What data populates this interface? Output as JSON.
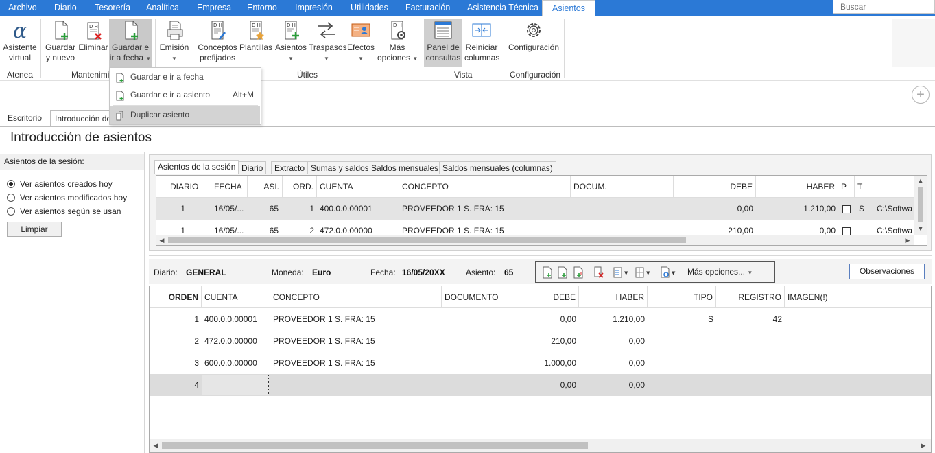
{
  "menu": [
    "Archivo",
    "Diario",
    "Tesorería",
    "Analítica",
    "Empresa",
    "Entorno",
    "Impresión",
    "Utilidades",
    "Facturación",
    "Asistencia Técnica",
    "Asientos"
  ],
  "search_placeholder": "Buscar",
  "ribbon": {
    "buttons": {
      "asistente": [
        "Asistente",
        "virtual"
      ],
      "guardar_nuevo": [
        "Guardar",
        "y nuevo"
      ],
      "eliminar": "Eliminar",
      "guardar_fecha": [
        "Guardar e",
        "ir a fecha"
      ],
      "emision": "Emisión",
      "conceptos": [
        "Conceptos",
        "prefijados"
      ],
      "plantillas": "Plantillas",
      "asientos": "Asientos",
      "traspasos": "Traspasos",
      "efectos": "Efectos",
      "mas_opciones": [
        "Más",
        "opciones"
      ],
      "panel": [
        "Panel de",
        "consultas"
      ],
      "reiniciar": [
        "Reiniciar",
        "columnas"
      ],
      "configuracion": "Configuración"
    },
    "groups": {
      "atenea": "Atenea",
      "mantenimiento": "Mantenimi",
      "utiles": "Útiles",
      "vista": "Vista",
      "configuracion": "Configuración"
    }
  },
  "dropdown": {
    "items": [
      {
        "label": "Guardar e ir a fecha",
        "shortcut": ""
      },
      {
        "label": "Guardar e ir a asiento",
        "shortcut": "Alt+M"
      },
      {
        "label": "Duplicar asiento",
        "shortcut": ""
      }
    ]
  },
  "page_tabs": [
    "Escritorio",
    "Introducción de"
  ],
  "page_title": "Introducción de asientos",
  "session": {
    "header": "Asientos de la sesión:",
    "options": [
      "Ver asientos creados hoy",
      "Ver asientos modificados hoy",
      "Ver asientos según se usan"
    ],
    "selected_index": 0,
    "clear_button": "Limpiar"
  },
  "upper_tabs": [
    "Asientos de la sesión",
    "Diario",
    "Extracto",
    "Sumas y saldos",
    "Saldos mensuales",
    "Saldos mensuales (columnas)"
  ],
  "upper_grid": {
    "columns": [
      "DIARIO",
      "FECHA",
      "ASI.",
      "ORD.",
      "CUENTA",
      "CONCEPTO",
      "DOCUM.",
      "DEBE",
      "HABER",
      "P",
      "T",
      ""
    ],
    "rows": [
      {
        "diario": "1",
        "fecha": "16/05/...",
        "asi": "65",
        "ord": "1",
        "cuenta": "400.0.0.00001",
        "concepto": "PROVEEDOR 1 S. FRA:  15",
        "docum": "",
        "debe": "0,00",
        "haber": "1.210,00",
        "t": "S",
        "ruta": "C:\\Softwa"
      },
      {
        "diario": "1",
        "fecha": "16/05/...",
        "asi": "65",
        "ord": "2",
        "cuenta": "472.0.0.00000",
        "concepto": "PROVEEDOR 1 S. FRA:  15",
        "docum": "",
        "debe": "210,00",
        "haber": "0,00",
        "t": "",
        "ruta": "C:\\Softwa"
      }
    ]
  },
  "entry": {
    "diario_label": "Diario:",
    "diario_value": "GENERAL",
    "moneda_label": "Moneda:",
    "moneda_value": "Euro",
    "fecha_label": "Fecha:",
    "fecha_value": "16/05/20XX",
    "asiento_label": "Asiento:",
    "asiento_value": "65",
    "more_options": "Más opciones...",
    "observaciones": "Observaciones"
  },
  "lines_grid": {
    "columns": [
      "ORDEN",
      "CUENTA",
      "CONCEPTO",
      "DOCUMENTO",
      "DEBE",
      "HABER",
      "TIPO",
      "REGISTRO",
      "IMAGEN(!)"
    ],
    "rows": [
      {
        "orden": "1",
        "cuenta": "400.0.0.00001",
        "concepto": "PROVEEDOR 1 S. FRA:  15",
        "documento": "",
        "debe": "0,00",
        "haber": "1.210,00",
        "tipo": "S",
        "registro": "42"
      },
      {
        "orden": "2",
        "cuenta": "472.0.0.00000",
        "concepto": "PROVEEDOR 1 S. FRA:  15",
        "documento": "",
        "debe": "210,00",
        "haber": "0,00",
        "tipo": "",
        "registro": ""
      },
      {
        "orden": "3",
        "cuenta": "600.0.0.00000",
        "concepto": "PROVEEDOR 1 S. FRA:  15",
        "documento": "",
        "debe": "1.000,00",
        "haber": "0,00",
        "tipo": "",
        "registro": ""
      },
      {
        "orden": "4",
        "cuenta": "",
        "concepto": "",
        "documento": "",
        "debe": "0,00",
        "haber": "0,00",
        "tipo": "",
        "registro": ""
      }
    ]
  },
  "colors": {
    "accent": "#2b79d6",
    "row_highlight": "#e4e4e4",
    "menu_selected": "#c9c9c9"
  }
}
